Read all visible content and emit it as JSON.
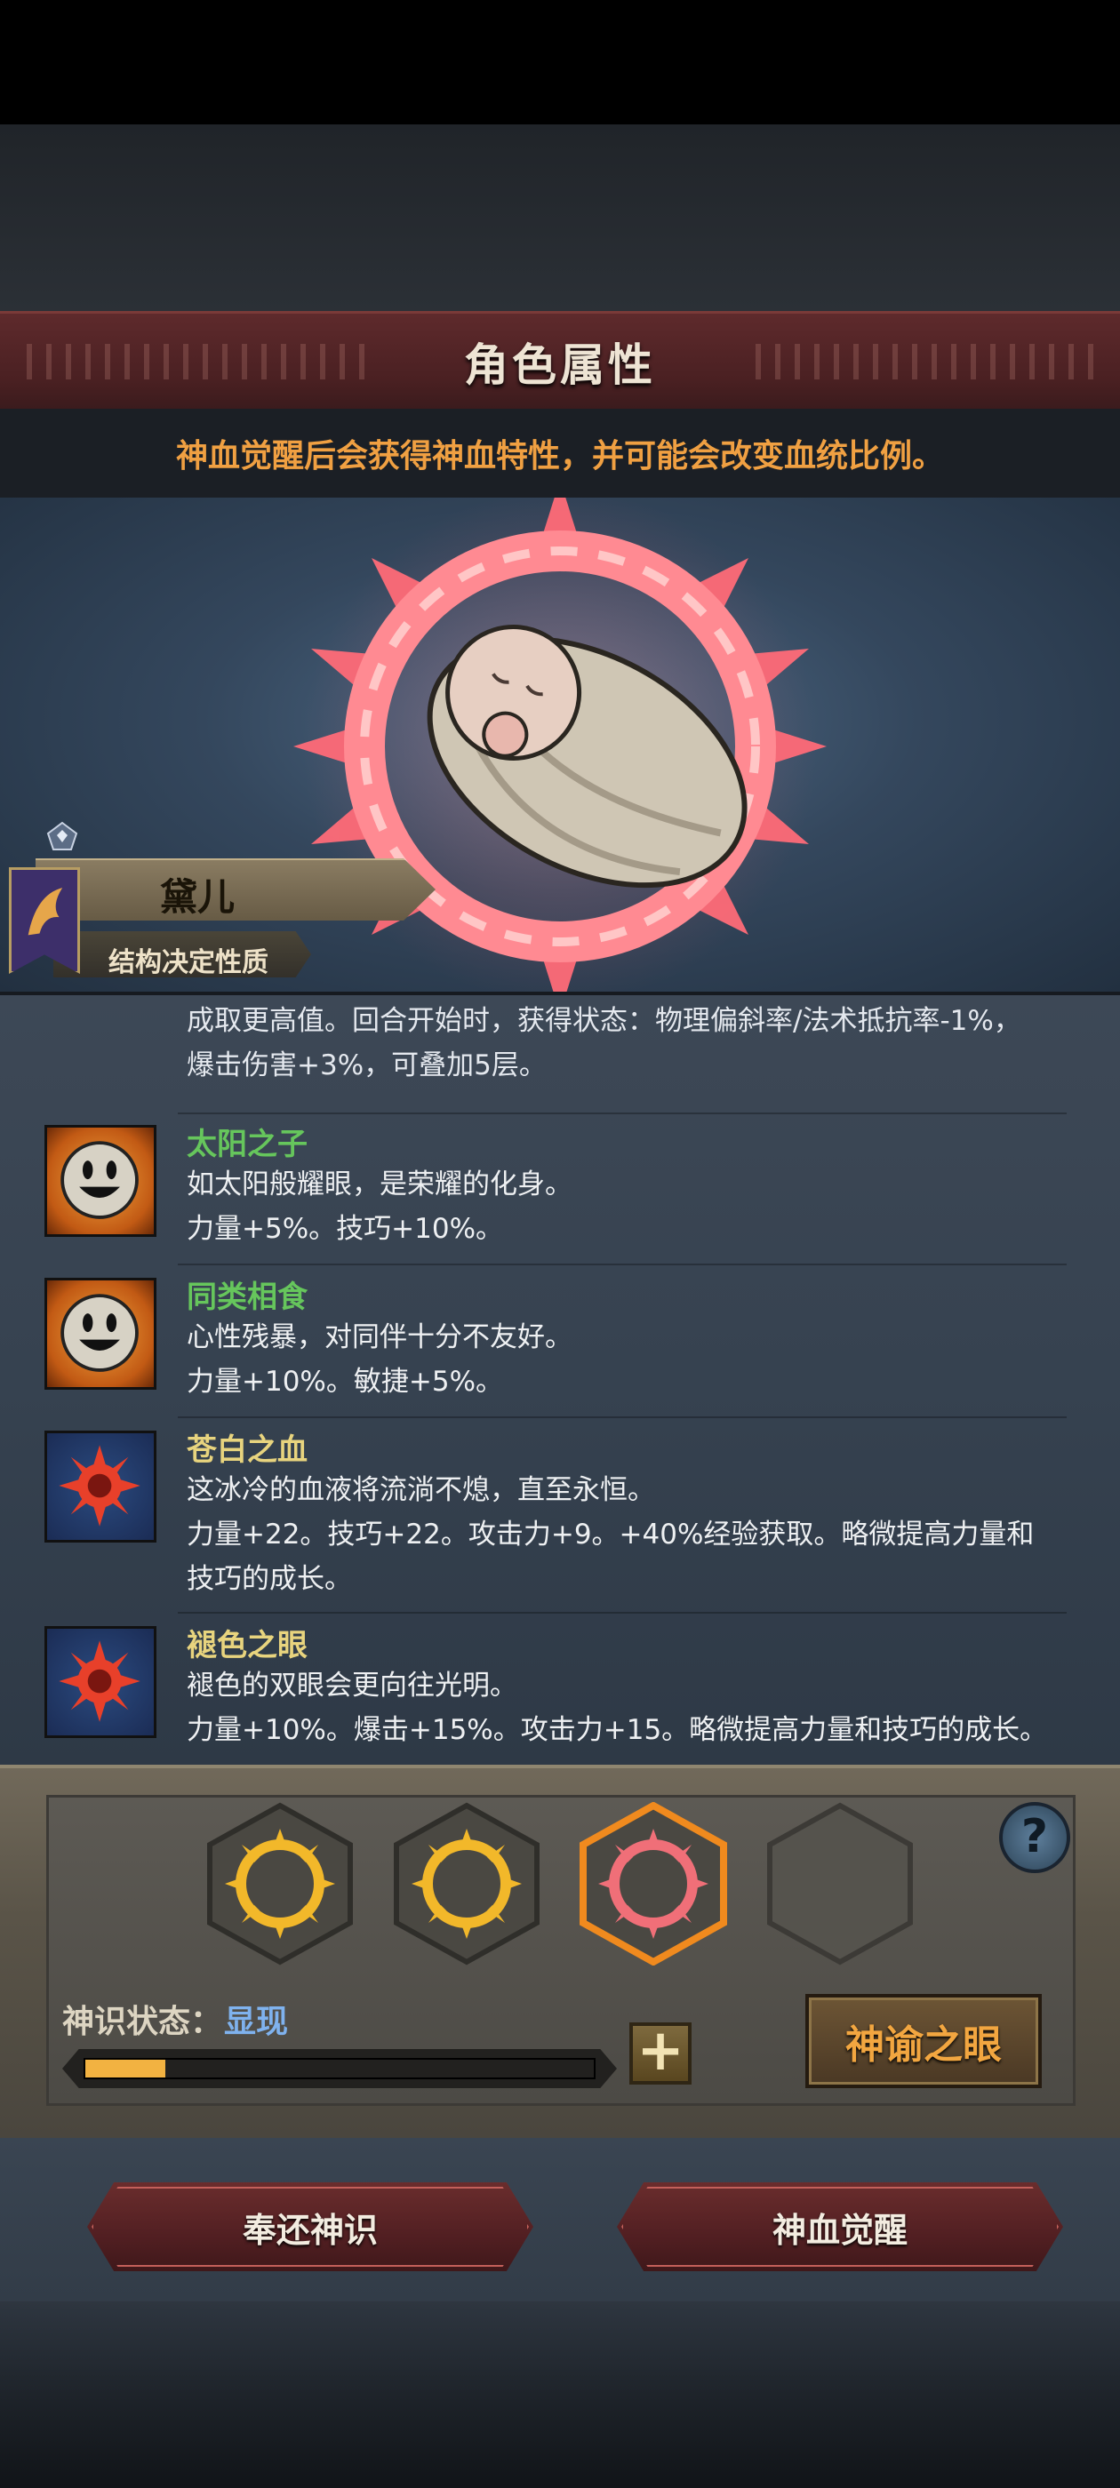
{
  "header": {
    "title": "角色属性"
  },
  "hint": {
    "text": "神血觉醒后会获得神血特性，并可能会改变血统比例。"
  },
  "character": {
    "name": "黛儿",
    "class": "结构决定性质"
  },
  "cut_trait": {
    "lines": [
      "成取更高值。回合开始时，获得状态：物理偏斜率/法术抵抗率-1%，",
      "爆击伤害+3%，可叠加5层。"
    ]
  },
  "traits": [
    {
      "name": "太阳之子",
      "name_color": "#66c65c",
      "desc": "如太阳般耀眼，是荣耀的化身。",
      "effect": "力量+5%。技巧+10%。",
      "icon": "smiley-sun-icon"
    },
    {
      "name": "同类相食",
      "name_color": "#66c65c",
      "desc": "心性残暴，对同伴十分不友好。",
      "effect": "力量+10%。敏捷+5%。",
      "icon": "smiley-sun-icon"
    },
    {
      "name": "苍白之血",
      "name_color": "#e8d47e",
      "desc": "这冰冷的血液将流淌不熄，直至永恒。",
      "effect": "力量+22。技巧+22。攻击力+9。+40%经验获取。略微提高力量和",
      "effect2": "技巧的成长。",
      "icon": "blood-sigil-icon"
    },
    {
      "name": "褪色之眼",
      "name_color": "#e8d47e",
      "desc": "褪色的双眼会更向往光明。",
      "effect": "力量+10%。爆击+15%。攻击力+15。略微提高力量和技巧的成长。",
      "icon": "blood-sigil-icon"
    }
  ],
  "sigils": [
    {
      "name": "gold-sun-ring-icon",
      "state": "gold"
    },
    {
      "name": "gold-sun-ring-icon",
      "state": "gold"
    },
    {
      "name": "red-sun-ring-icon",
      "state": "active"
    },
    {
      "name": "empty-hex-slot",
      "state": "empty"
    }
  ],
  "status": {
    "label": "神识状态：",
    "value": "显现",
    "progress": 0.16
  },
  "buttons": {
    "oracle": "神谕之眼",
    "return": "奉还神识",
    "awaken": "神血觉醒",
    "help": "?"
  },
  "colors": {
    "accent_orange": "#f0a042",
    "status_blue": "#7fb2ee",
    "banner_red": "#5e2a2c"
  }
}
